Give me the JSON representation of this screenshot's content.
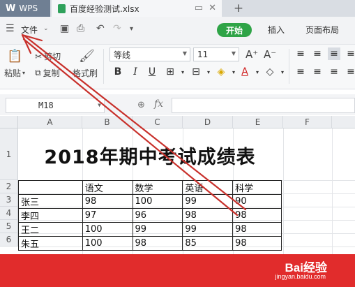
{
  "tabs": {
    "app_label": "WPS",
    "app_logo": "W",
    "file_name": "百度经验测试.xlsx",
    "new_tab": "+"
  },
  "menu": {
    "file_label": "文件",
    "tab_start": "开始",
    "tab_insert": "插入",
    "tab_layout": "页面布局"
  },
  "toolbar": {
    "paste_label": "粘贴",
    "cut_label": "剪切",
    "copy_label": "复制",
    "format_painter_label": "格式刷",
    "font_name": "等线",
    "font_size": "11",
    "grow_font": "A⁺",
    "shrink_font": "A⁻",
    "bold": "B",
    "italic": "I",
    "underline": "U"
  },
  "formula_bar": {
    "cell_ref": "M18",
    "fx": "fx",
    "value": ""
  },
  "sheet": {
    "columns": [
      "A",
      "B",
      "C",
      "D",
      "E",
      "F"
    ],
    "rows": [
      "1",
      "2",
      "3",
      "4",
      "5",
      "6"
    ],
    "title": "2018年期中考试成绩表",
    "headers": [
      "",
      "语文",
      "数学",
      "英语",
      "科学"
    ],
    "data": [
      [
        "张三",
        "98",
        "100",
        "99",
        "90"
      ],
      [
        "李四",
        "97",
        "96",
        "98",
        "98"
      ],
      [
        "王二",
        "100",
        "99",
        "99",
        "98"
      ],
      [
        "朱五",
        "100",
        "98",
        "85",
        "98"
      ]
    ]
  },
  "watermark": {
    "brand": "Bai经验",
    "url": "jingyan.baidu.com"
  },
  "colors": {
    "accent_green": "#2fa447",
    "watermark_red": "#e12c2c",
    "arrow_red": "#c8302b"
  }
}
